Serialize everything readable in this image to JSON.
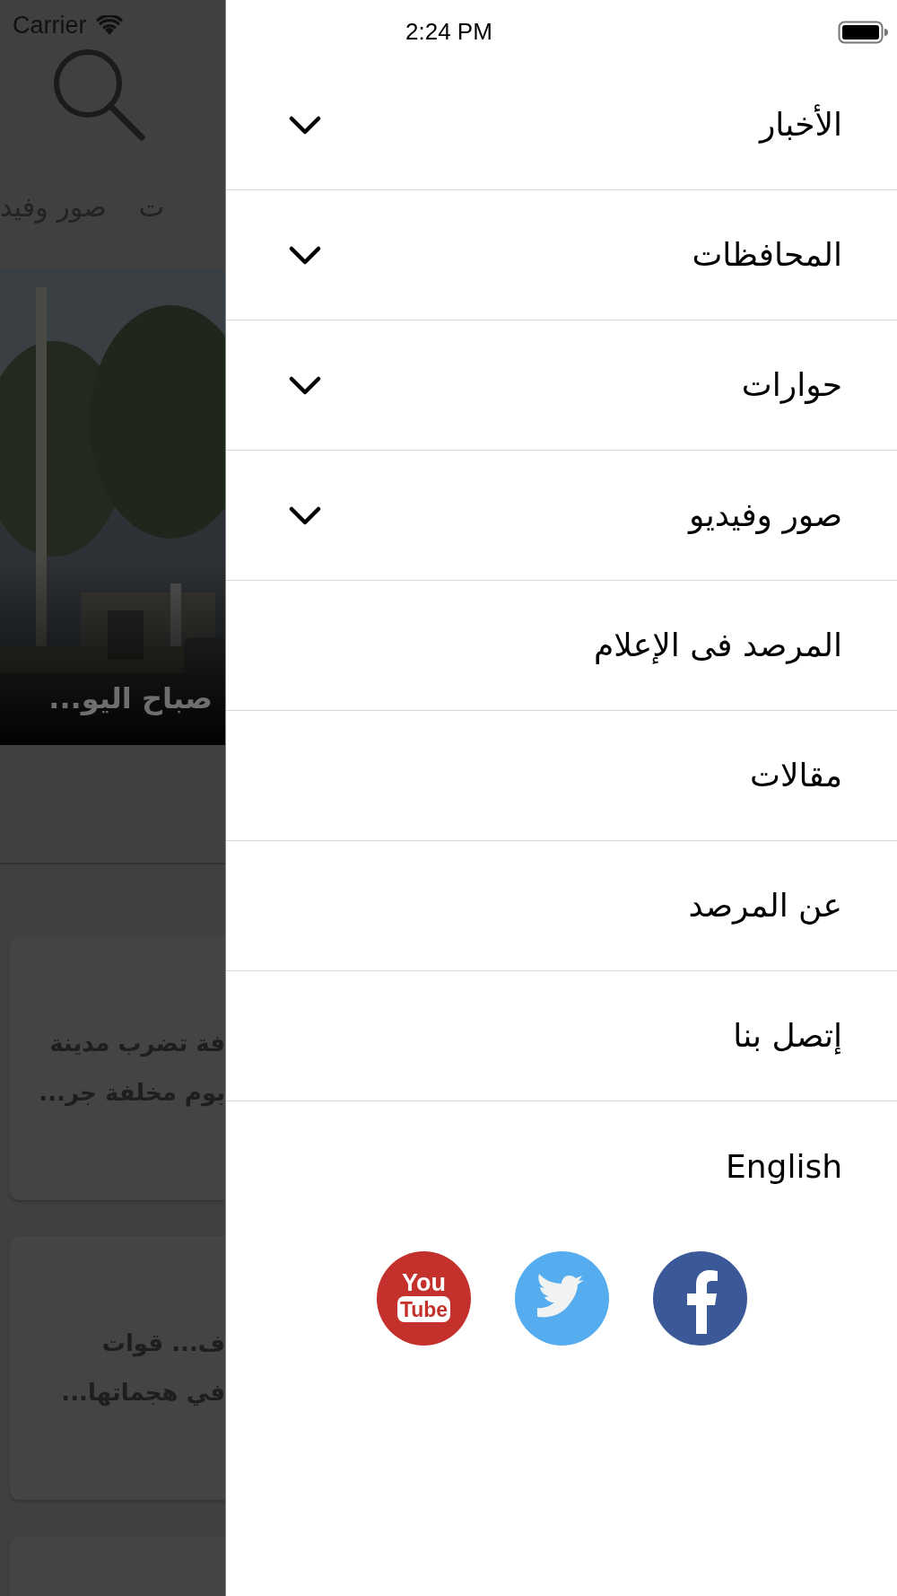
{
  "status_bar": {
    "carrier": "Carrier",
    "time": "2:24 PM"
  },
  "background": {
    "tabs": [
      "ت",
      "صور وفيد"
    ],
    "featured": {
      "kind": "picture",
      "title": "صباح اليو..."
    },
    "cards": [
      {
        "kind": "text",
        "lines": [
          "فة تضرب مدينة",
          "بوم مخلفة جر..."
        ]
      },
      {
        "kind": "text",
        "lines": [
          "ف... قوات",
          "في هجماتها..."
        ]
      },
      {
        "kind": "blank"
      }
    ]
  },
  "menu": [
    {
      "label": "الأخبار",
      "kind": "submenu",
      "expanded": false
    },
    {
      "label": "المحافظات",
      "kind": "submenu",
      "expanded": false
    },
    {
      "label": "حوارات",
      "kind": "submenu",
      "expanded": false
    },
    {
      "label": "صور وفيديو",
      "kind": "submenu",
      "expanded": false
    },
    {
      "label": "المرصد فى الإعلام",
      "kind": "link"
    },
    {
      "label": "مقالات",
      "kind": "link"
    },
    {
      "label": "عن المرصد",
      "kind": "link"
    },
    {
      "label": "إتصل بنا",
      "kind": "link"
    },
    {
      "label": "English",
      "kind": "link"
    }
  ],
  "social": [
    {
      "kind": "youtube",
      "top_word": "You",
      "bottom_word": "Tube"
    },
    {
      "kind": "twitter"
    },
    {
      "kind": "facebook"
    }
  ]
}
